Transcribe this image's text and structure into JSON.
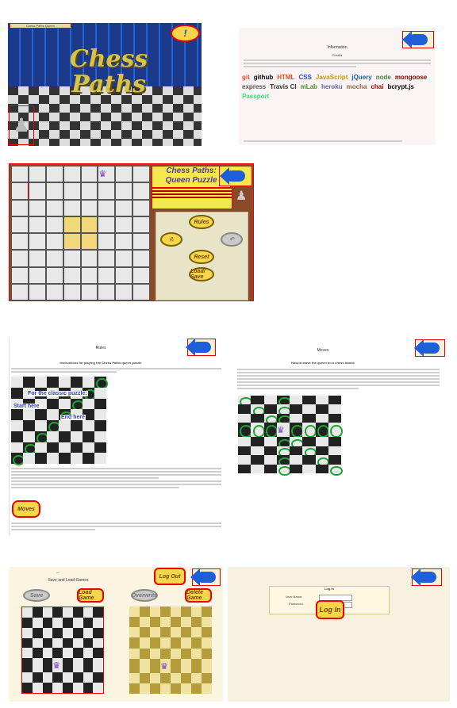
{
  "splash": {
    "title_line1": "Chess",
    "title_line2": "Paths",
    "top_label": "Chess Paths Queen",
    "info_button": "!"
  },
  "information": {
    "title": "Information",
    "credits_heading": "Credits",
    "logos": [
      "git",
      "github",
      "HTML",
      "CSS",
      "JavaScript",
      "jQuery",
      "node",
      "mongoose",
      "express",
      "Travis CI",
      "mLab",
      "heroku",
      "mocha",
      "chai",
      "bcrypt.js",
      "Passport"
    ]
  },
  "game": {
    "title_line1": "Chess Paths:",
    "title_line2": "Queen Puzzle",
    "buttons": {
      "rules": "Rules",
      "reset": "Reset",
      "load_save": "Load/ Save"
    }
  },
  "rules": {
    "title": "Rules",
    "heading": "Instructions for playing the Chess Paths queen puzzle",
    "classic_label": "For the classic puzzle:",
    "start_label": "Start here",
    "end_label": "End here",
    "moves_button": "Moves"
  },
  "moves": {
    "title": "Moves",
    "heading": "How to move the queen on a chess board:"
  },
  "save_load": {
    "title": "Save and Load Games",
    "logout_button": "Log Out",
    "load_button": "Load Game",
    "delete_button": "Delete Game",
    "save_button": "Save",
    "overwrite_button": "Overwrite"
  },
  "login": {
    "heading": "Log In",
    "username_label": "User Name:",
    "password_label": "Password:",
    "login_button": "Log In"
  },
  "colors": {
    "accent": "#1e5ed8",
    "highlight_red": "#ee0000",
    "button_yellow": "#f3d64a",
    "title_purple": "#5b2fb5"
  }
}
